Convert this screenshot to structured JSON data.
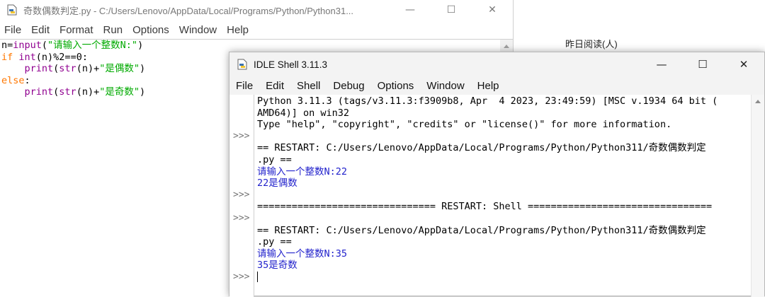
{
  "editor": {
    "title": "奇数偶数判定.py - C:/Users/Lenovo/AppData/Local/Programs/Python/Python31...",
    "menu": [
      "File",
      "Edit",
      "Format",
      "Run",
      "Options",
      "Window",
      "Help"
    ],
    "code": {
      "l1_a": "n=",
      "l1_b": "input",
      "l1_c": "(",
      "l1_d": "\"请输入一个整数N:\"",
      "l1_e": ")",
      "l2_a": "if",
      "l2_b": " ",
      "l2_c": "int",
      "l2_d": "(n)%2==0:",
      "l3_a": "    ",
      "l3_b": "print",
      "l3_c": "(",
      "l3_d": "str",
      "l3_e": "(n)+",
      "l3_f": "\"是偶数\"",
      "l3_g": ")",
      "l4_a": "else",
      "l4_b": ":",
      "l5_a": "    ",
      "l5_b": "print",
      "l5_c": "(",
      "l5_d": "str",
      "l5_e": "(n)+",
      "l5_f": "\"是奇数\"",
      "l5_g": ")"
    }
  },
  "background_label": "昨日阅读(人)",
  "shell": {
    "title": "IDLE Shell 3.11.3",
    "menu": [
      "File",
      "Edit",
      "Shell",
      "Debug",
      "Options",
      "Window",
      "Help"
    ],
    "prompt": ">>>",
    "lines": {
      "banner1": "Python 3.11.3 (tags/v3.11.3:f3909b8, Apr  4 2023, 23:49:59) [MSC v.1934 64 bit (",
      "banner2": "AMD64)] on win32",
      "banner3": "Type \"help\", \"copyright\", \"credits\" or \"license()\" for more information.",
      "restart1a": "== RESTART: C:/Users/Lenovo/AppData/Local/Programs/Python/Python311/奇数偶数判定",
      "restart1b": ".py ==",
      "input1": "请输入一个整数N:22",
      "output1": "22是偶数",
      "restart_shell": "=============================== RESTART: Shell ================================",
      "restart2a": "== RESTART: C:/Users/Lenovo/AppData/Local/Programs/Python/Python311/奇数偶数判定",
      "restart2b": ".py ==",
      "input2": "请输入一个整数N:35",
      "output2": "35是奇数"
    }
  },
  "window_buttons": {
    "minimize": "—",
    "maximize": "☐",
    "close": "✕"
  },
  "colors": {
    "keyword": "#ff7700",
    "builtin": "#900090",
    "string": "#00aa00",
    "shell_output": "#2222cc"
  }
}
